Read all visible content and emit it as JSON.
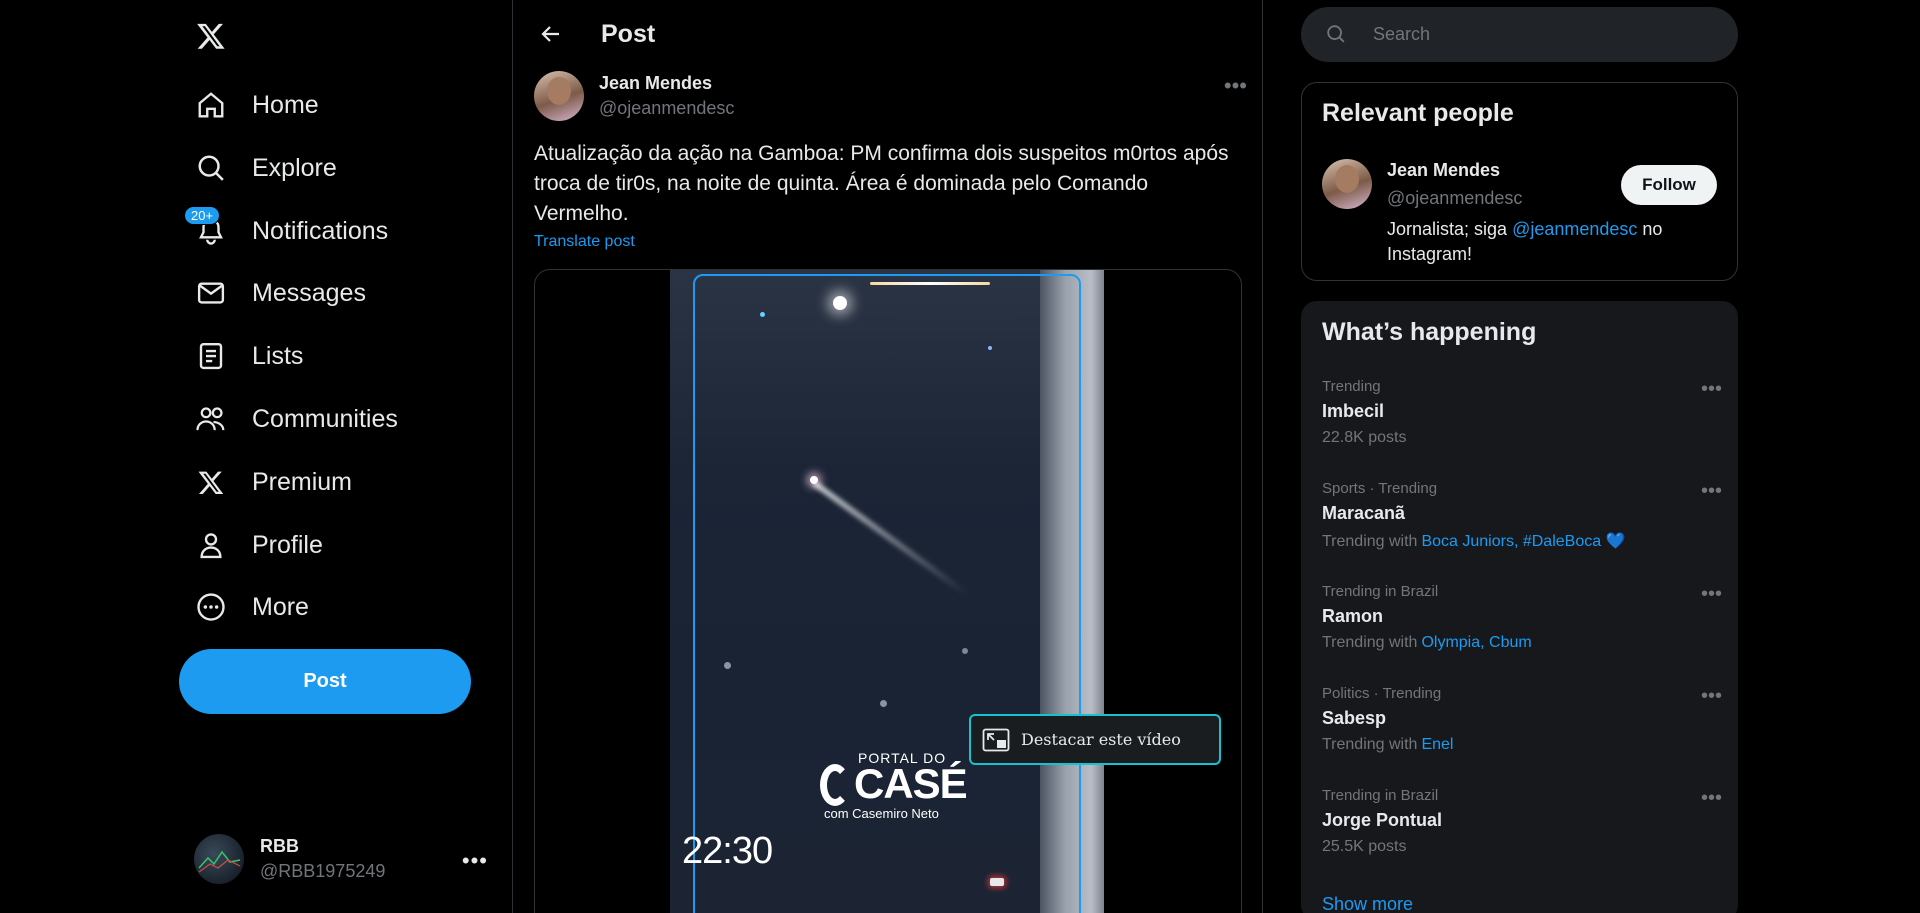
{
  "nav": {
    "items": [
      {
        "label": "Home",
        "icon": "home-icon"
      },
      {
        "label": "Explore",
        "icon": "search-icon"
      },
      {
        "label": "Notifications",
        "icon": "bell-icon",
        "badge": "20+"
      },
      {
        "label": "Messages",
        "icon": "mail-icon"
      },
      {
        "label": "Lists",
        "icon": "list-icon"
      },
      {
        "label": "Communities",
        "icon": "people-icon"
      },
      {
        "label": "Premium",
        "icon": "x-logo-icon"
      },
      {
        "label": "Profile",
        "icon": "person-icon"
      },
      {
        "label": "More",
        "icon": "more-circle-icon"
      }
    ],
    "post_label": "Post"
  },
  "account": {
    "name": "RBB",
    "handle": "@RBB1975249"
  },
  "header": {
    "title": "Post"
  },
  "tweet": {
    "author_name": "Jean Mendes",
    "author_handle": "@ojeanmendesc",
    "text": "Atualização da ação na Gamboa: PM confirma dois suspeitos m0rtos após troca de tir0s, na noite de quinta. Área é dominada pelo Comando Vermelho.",
    "translate": "Translate post",
    "video": {
      "watermark_top": "PORTAL DO",
      "watermark_main": "CASÉ",
      "watermark_sub": "com Casemiro Neto",
      "timestamp": "22:30"
    }
  },
  "pip_popup": {
    "label": "Destacar este vídeo"
  },
  "search": {
    "placeholder": "Search"
  },
  "relevant": {
    "title": "Relevant people",
    "name": "Jean Mendes",
    "handle": "@ojeanmendesc",
    "bio_before": "Jornalista; siga ",
    "bio_link": "@jeanmendesc",
    "bio_after": " no Instagram!",
    "follow_label": "Follow"
  },
  "trends": {
    "title": "What’s happening",
    "items": [
      {
        "context": "Trending",
        "name": "Imbecil",
        "sub": "22.8K posts",
        "links": ""
      },
      {
        "context": "Sports · Trending",
        "name": "Maracanã",
        "sub": "Trending with",
        "links": "Boca Juniors, #DaleBoca 💙"
      },
      {
        "context": "Trending in Brazil",
        "name": "Ramon",
        "sub": "Trending with",
        "links": "Olympia, Cbum"
      },
      {
        "context": "Politics · Trending",
        "name": "Sabesp",
        "sub": "Trending with",
        "links": "Enel"
      },
      {
        "context": "Trending in Brazil",
        "name": "Jorge Pontual",
        "sub": "25.5K posts",
        "links": ""
      }
    ],
    "show_more": "Show more"
  },
  "colors": {
    "accent": "#1d9bf0",
    "background": "#000000",
    "text": "#e7e9ea",
    "muted": "#71767b"
  }
}
